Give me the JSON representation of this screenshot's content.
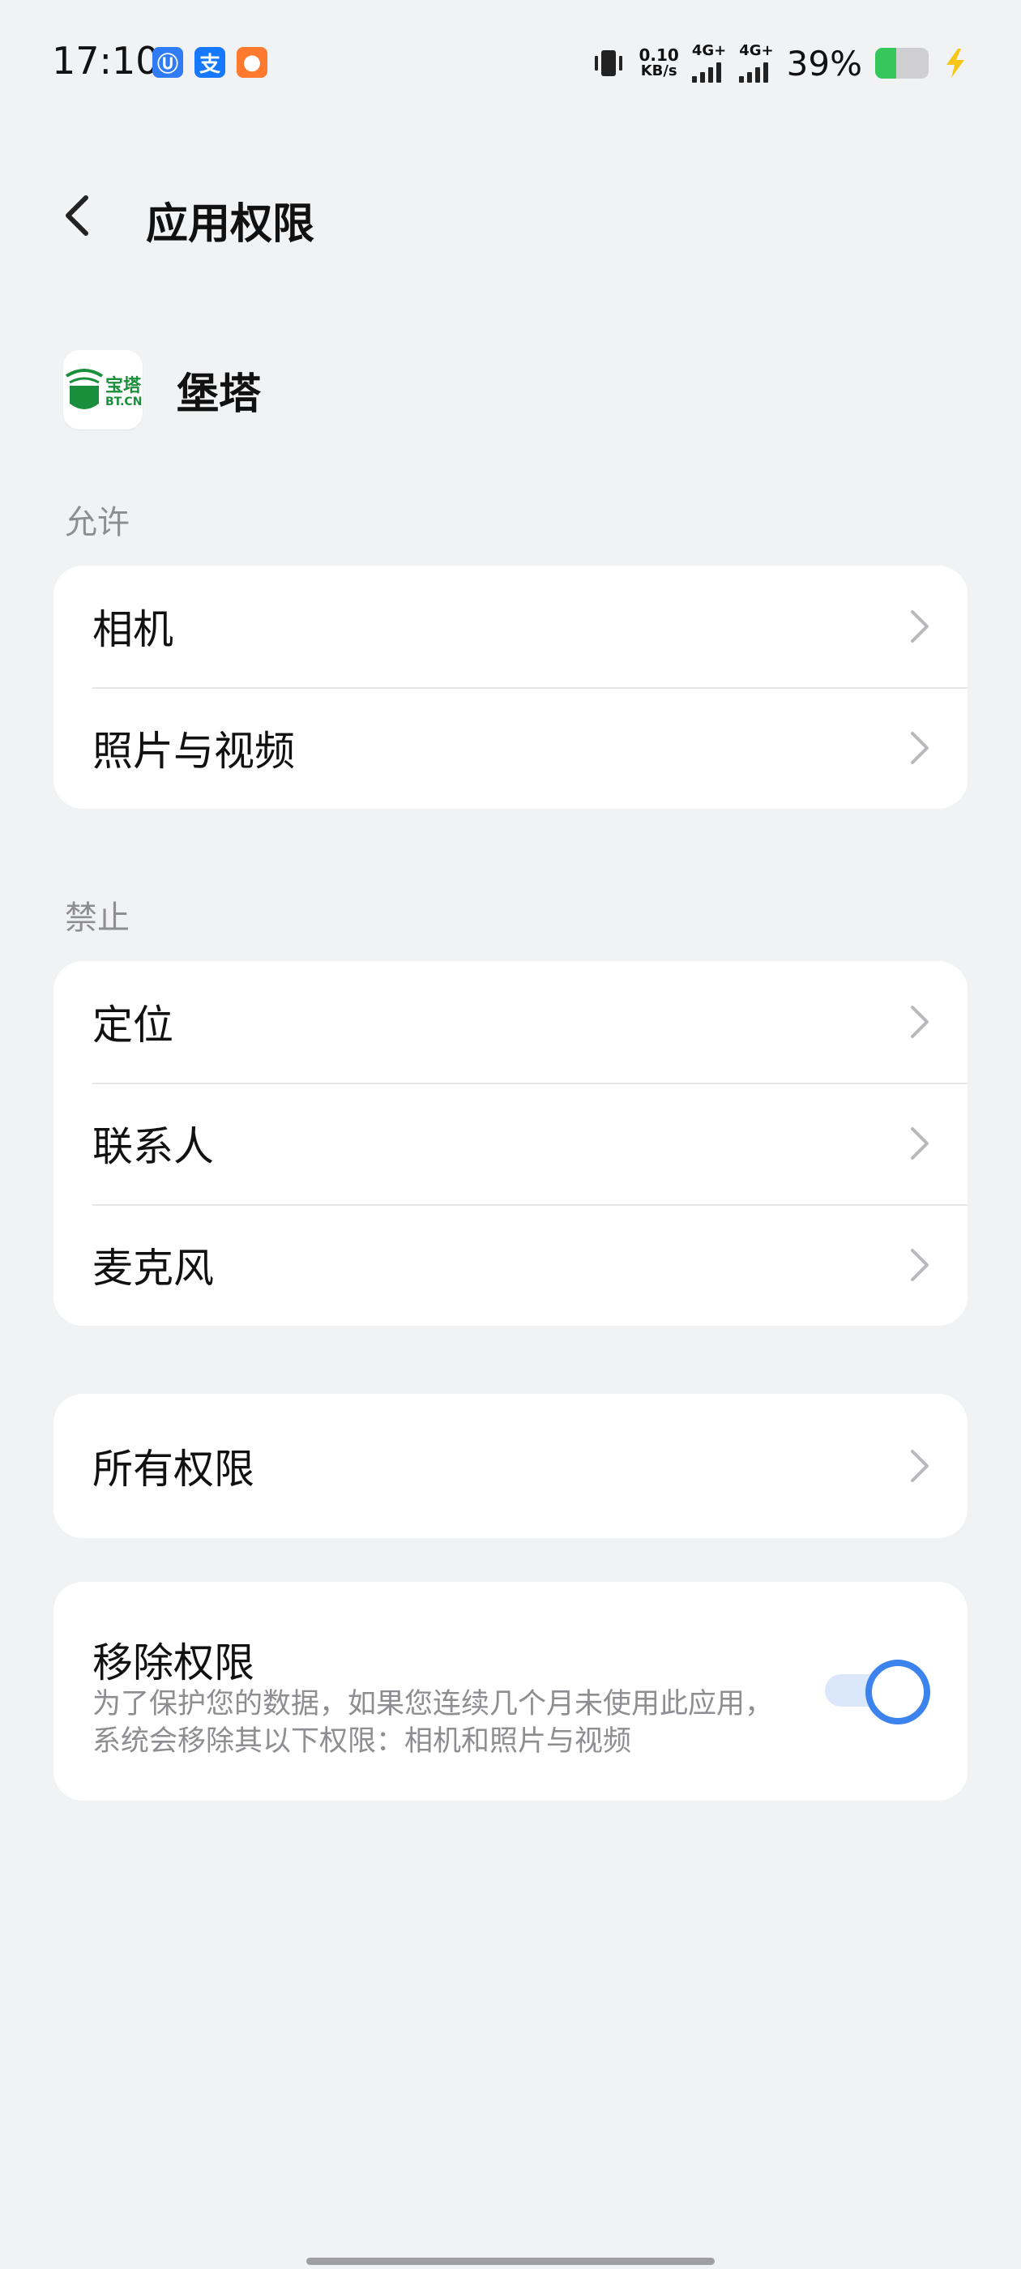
{
  "status_bar": {
    "time": "17:10",
    "net_speed_value": "0.10",
    "net_speed_unit": "KB/s",
    "signal1_label": "4G+",
    "signal2_label": "4G+",
    "battery_percent": "39%",
    "battery_level": 0.39,
    "notif_icons": [
      {
        "name": "app-notif-icon-1",
        "glyph": "Ⓤ",
        "color": "#2f7cf6"
      },
      {
        "name": "alipay-notif-icon",
        "glyph": "支",
        "color": "#1677ff"
      },
      {
        "name": "app-notif-icon-3",
        "glyph": "◉",
        "color": "#ff7a2f"
      }
    ]
  },
  "header": {
    "title": "应用权限"
  },
  "app": {
    "name": "堡塔",
    "logo_text_cn": "宝塔",
    "logo_text_en": "BT.CN"
  },
  "sections": {
    "allowed_label": "允许",
    "allowed_items": [
      "相机",
      "照片与视频"
    ],
    "denied_label": "禁止",
    "denied_items": [
      "定位",
      "联系人",
      "麦克风"
    ],
    "all_permissions": "所有权限"
  },
  "remove_permissions": {
    "title": "移除权限",
    "description": "为了保护您的数据，如果您连续几个月未使用此应用，系统会移除其以下权限：相机和照片与视频",
    "enabled": true
  },
  "colors": {
    "background": "#f1f2f4",
    "card": "#ffffff",
    "accent": "#3c83ee",
    "secondary_text": "#8d8d92",
    "logo_green": "#1a8f3b"
  }
}
